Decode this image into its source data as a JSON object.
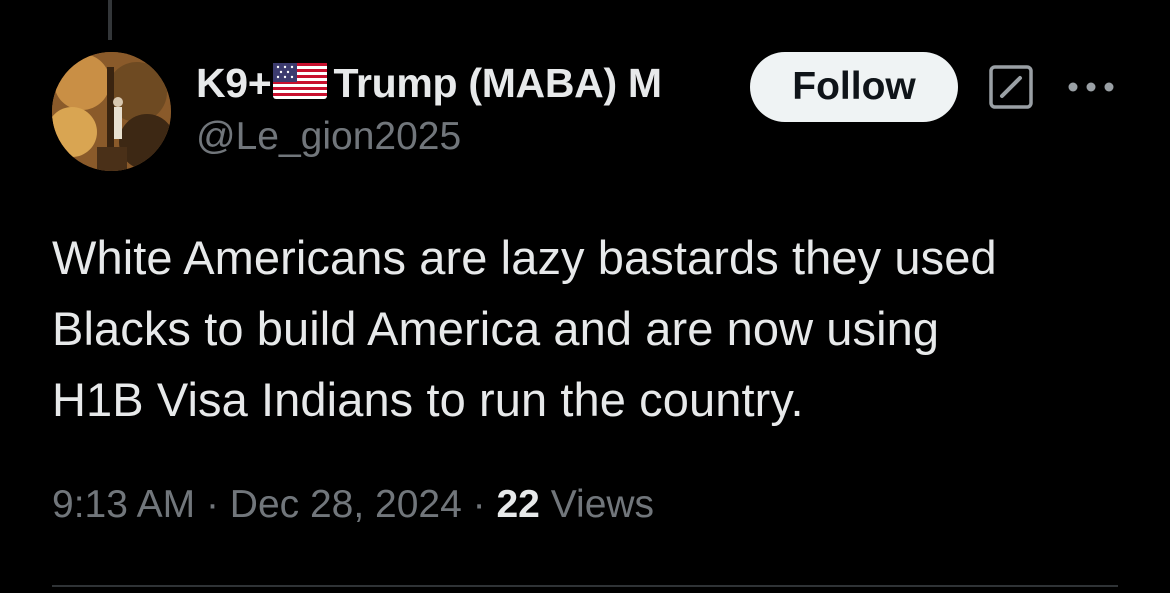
{
  "tweet": {
    "author": {
      "name_prefix": "K9+",
      "name_flag": "us-flag-icon",
      "name_suffix": "Trump (MABA) M",
      "handle": "@Le_gion2025"
    },
    "follow_label": "Follow",
    "text": "White Americans are lazy bastards they used\nBlacks to build America and are now using\nH1B Visa Indians to run the country.",
    "time": "9:13 AM",
    "separator": "·",
    "date": "Dec 28, 2024",
    "views_count": "22",
    "views_label": "Views"
  },
  "colors": {
    "background": "#000000",
    "primary_text": "#e7e9ea",
    "secondary_text": "#71767b",
    "follow_bg": "#eff3f4"
  },
  "icons": {
    "grok": "grok-icon",
    "more": "more-icon"
  }
}
